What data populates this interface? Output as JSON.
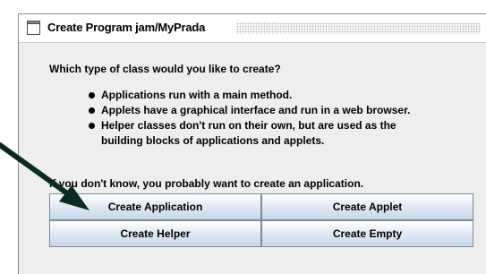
{
  "window": {
    "title": "Create Program jam/MyPrada",
    "icon": "window-icon"
  },
  "dialog": {
    "question": "Which type of class would you like to create?",
    "bullets": [
      "Applications run with a main method.",
      "Applets have a graphical interface and run in a web browser.",
      "Helper classes don't run on their own, but are used as the",
      "building blocks of applications and applets."
    ],
    "advice": "If you don't know, you probably want to create an application.",
    "buttons": {
      "create_application": "Create Application",
      "create_applet": "Create Applet",
      "create_helper": "Create Helper",
      "create_empty": "Create Empty"
    }
  },
  "annotation": {
    "arrow_color": "#0b2a24",
    "icon": "pointer-arrow"
  },
  "colors": {
    "dialog_background": "#eeeeee",
    "button_border": "#7a8a99",
    "button_gradient_bottom": "#c7d6e8"
  }
}
